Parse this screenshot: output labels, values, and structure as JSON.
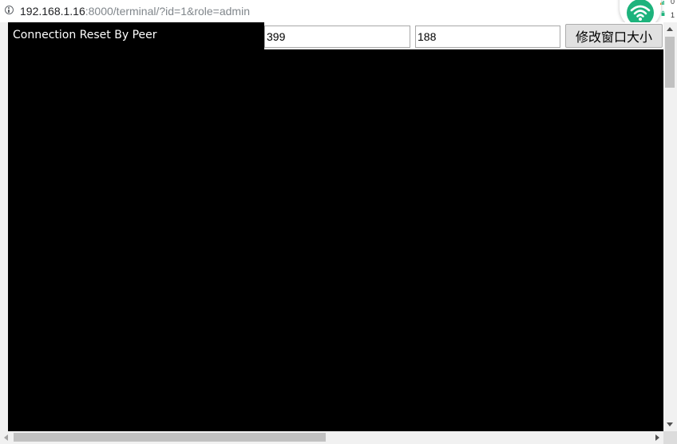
{
  "address_bar": {
    "url_host": "192.168.1.16",
    "url_rest": ":8000/terminal/?id=1&role=admin",
    "info_icon": "info-circle-icon"
  },
  "tray": {
    "wifi_icon": "wifi-icon",
    "num_top": "0",
    "num_bottom": "1",
    "accent": "#1db37c"
  },
  "terminal": {
    "status_text": "Connection Reset By Peer",
    "background": "#000000",
    "text_color": "#ffffff"
  },
  "controls": {
    "width_value": "399",
    "height_value": "188",
    "resize_label": "修改窗口大小"
  }
}
